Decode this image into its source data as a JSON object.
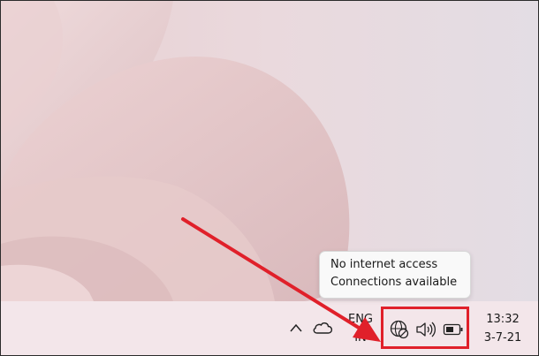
{
  "tooltip": {
    "line1": "No internet access",
    "line2": "Connections available"
  },
  "tray": {
    "overflow_icon": "chevron-up-icon",
    "onedrive_icon": "cloud-icon",
    "language_line1": "ENG",
    "language_line2": "IN",
    "network_icon": "globe-no-internet-icon",
    "volume_icon": "speaker-icon",
    "battery_icon": "battery-icon"
  },
  "clock": {
    "time": "13:32",
    "date": "3-7-21"
  },
  "colors": {
    "taskbar": "#f3e6ea",
    "highlight": "#e0202a",
    "arrow": "#e0202a",
    "wallpaper_base": "#e6d8dc"
  }
}
